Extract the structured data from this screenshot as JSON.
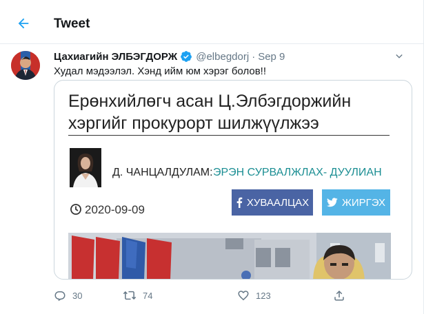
{
  "header": {
    "title": "Tweet",
    "back_icon": "arrow-left-icon"
  },
  "tweet": {
    "author": {
      "name": "Цахиагийн ЭЛБЭГДОРЖ",
      "handle": "@elbegdorj",
      "verified": true
    },
    "separator": "·",
    "date": "Sep 9",
    "text": "Худал мэдээлэл. Хэнд ийм юм хэрэг болов!!",
    "card": {
      "headline": "Ерөнхийлөгч асан Ц.Элбэгдоржийн хэргийг прокурорт шилжүүлжээ",
      "author_name": "Д. ЧАНЦАЛДУЛАМ:",
      "author_source": "ЭРЭН СУРВАЛЖЛАХ- ДУУЛИАН",
      "article_date": "2020-09-09",
      "share_facebook_label": "ХУВААЛЦАХ",
      "share_twitter_label": "ЖИРГЭХ"
    },
    "actions": {
      "replies": "30",
      "retweets": "74",
      "likes": "123"
    }
  },
  "colors": {
    "accent": "#1da1f2",
    "facebook": "#4a64a4",
    "twitter_share": "#54b4e6",
    "source_teal": "#1b8e93",
    "muted_text": "#657786"
  }
}
